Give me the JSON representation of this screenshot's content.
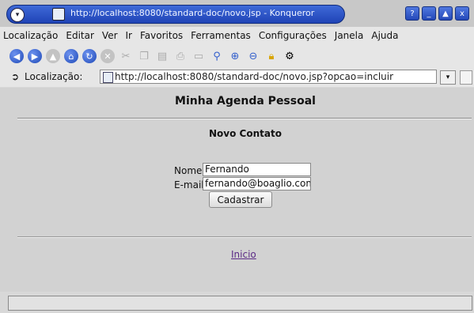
{
  "window": {
    "title": "http://localhost:8080/standard-doc/novo.jsp - Konqueror",
    "controls": [
      "?",
      "_",
      "▲",
      "x"
    ]
  },
  "menu": [
    "Localização",
    "Editar",
    "Ver",
    "Ir",
    "Favoritos",
    "Ferramentas",
    "Configurações",
    "Janela",
    "Ajuda"
  ],
  "toolbar": {
    "icons": [
      "back-icon",
      "forward-icon",
      "up-icon",
      "home-icon",
      "reload-icon",
      "stop-icon",
      "cut-icon",
      "copy-icon",
      "paste-icon",
      "print-icon",
      "print-frame-icon",
      "find-icon",
      "zoom-in-icon",
      "zoom-out-icon",
      "security-lock-icon",
      "konqueror-gear-icon"
    ]
  },
  "location": {
    "label": "Localização:",
    "url": "http://localhost:8080/standard-doc/novo.jsp?opcao=incluir"
  },
  "page": {
    "title": "Minha Agenda Pessoal",
    "subtitle": "Novo Contato",
    "form": {
      "nome_label": "Nome:",
      "nome_value": "Fernando",
      "email_label": "E-mail:",
      "email_value": "fernando@boaglio.com",
      "submit_label": "Cadastrar"
    },
    "link_inicio": "Inicio"
  },
  "statusbar": {
    "text": ""
  }
}
